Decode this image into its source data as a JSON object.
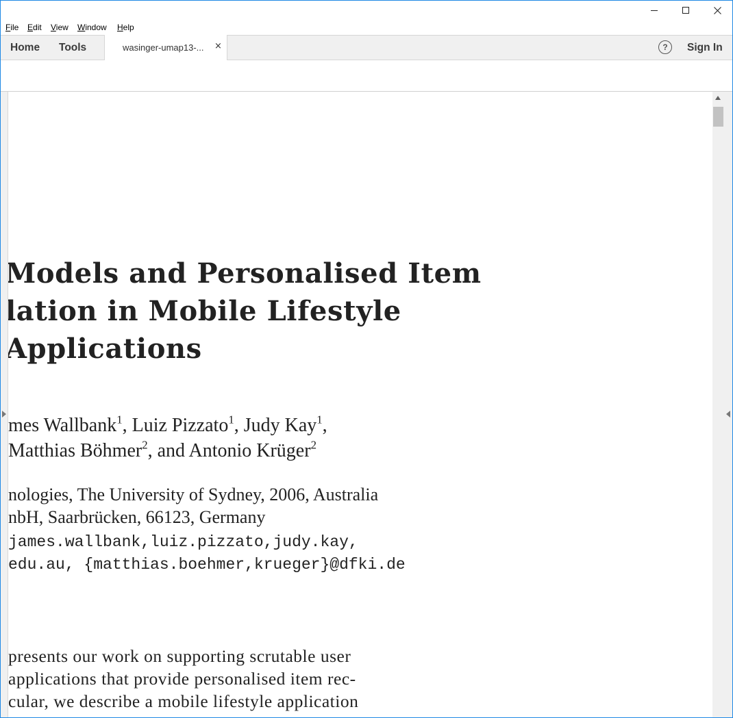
{
  "window": {
    "controls": {
      "minimize": "—",
      "maximize": "☐",
      "close": "✕"
    }
  },
  "menubar": {
    "items": [
      {
        "label": "File",
        "underline": "F",
        "rest": "ile"
      },
      {
        "label": "Edit",
        "underline": "E",
        "rest": "dit"
      },
      {
        "label": "View",
        "underline": "V",
        "rest": "iew"
      },
      {
        "label": "Window",
        "underline": "W",
        "rest": "indow"
      },
      {
        "label": "Help",
        "underline": "H",
        "rest": "elp"
      }
    ]
  },
  "tabbar": {
    "home": "Home",
    "tools": "Tools",
    "doc_tab": {
      "label": "wasinger-umap13-...",
      "close": "×"
    },
    "help": "?",
    "sign_in": "Sign In"
  },
  "document": {
    "title_lines": [
      "Models and Personalised Item",
      "lation in Mobile Lifestyle",
      " Applications"
    ],
    "authors": {
      "line1": [
        {
          "text": "mes Wallbank",
          "sup": "1"
        },
        {
          "text": ", Luiz Pizzato",
          "sup": "1"
        },
        {
          "text": ", Judy Kay",
          "sup": "1"
        },
        {
          "text": ",",
          "sup": ""
        }
      ],
      "line2": [
        {
          "text": "Matthias Böhmer",
          "sup": "2"
        },
        {
          "text": ", and Antonio Krüger",
          "sup": "2"
        }
      ]
    },
    "affiliations": [
      "nologies, The University of Sydney, 2006, Australia",
      "nbH, Saarbrücken, 66123, Germany"
    ],
    "emails": [
      "james.wallbank,luiz.pizzato,judy.kay,",
      "edu.au, {matthias.boehmer,krueger}@dfki.de"
    ],
    "abstract_lines": [
      "presents our work on supporting scrutable user",
      " applications that provide personalised item rec-",
      "cular, we describe a mobile lifestyle application"
    ]
  }
}
